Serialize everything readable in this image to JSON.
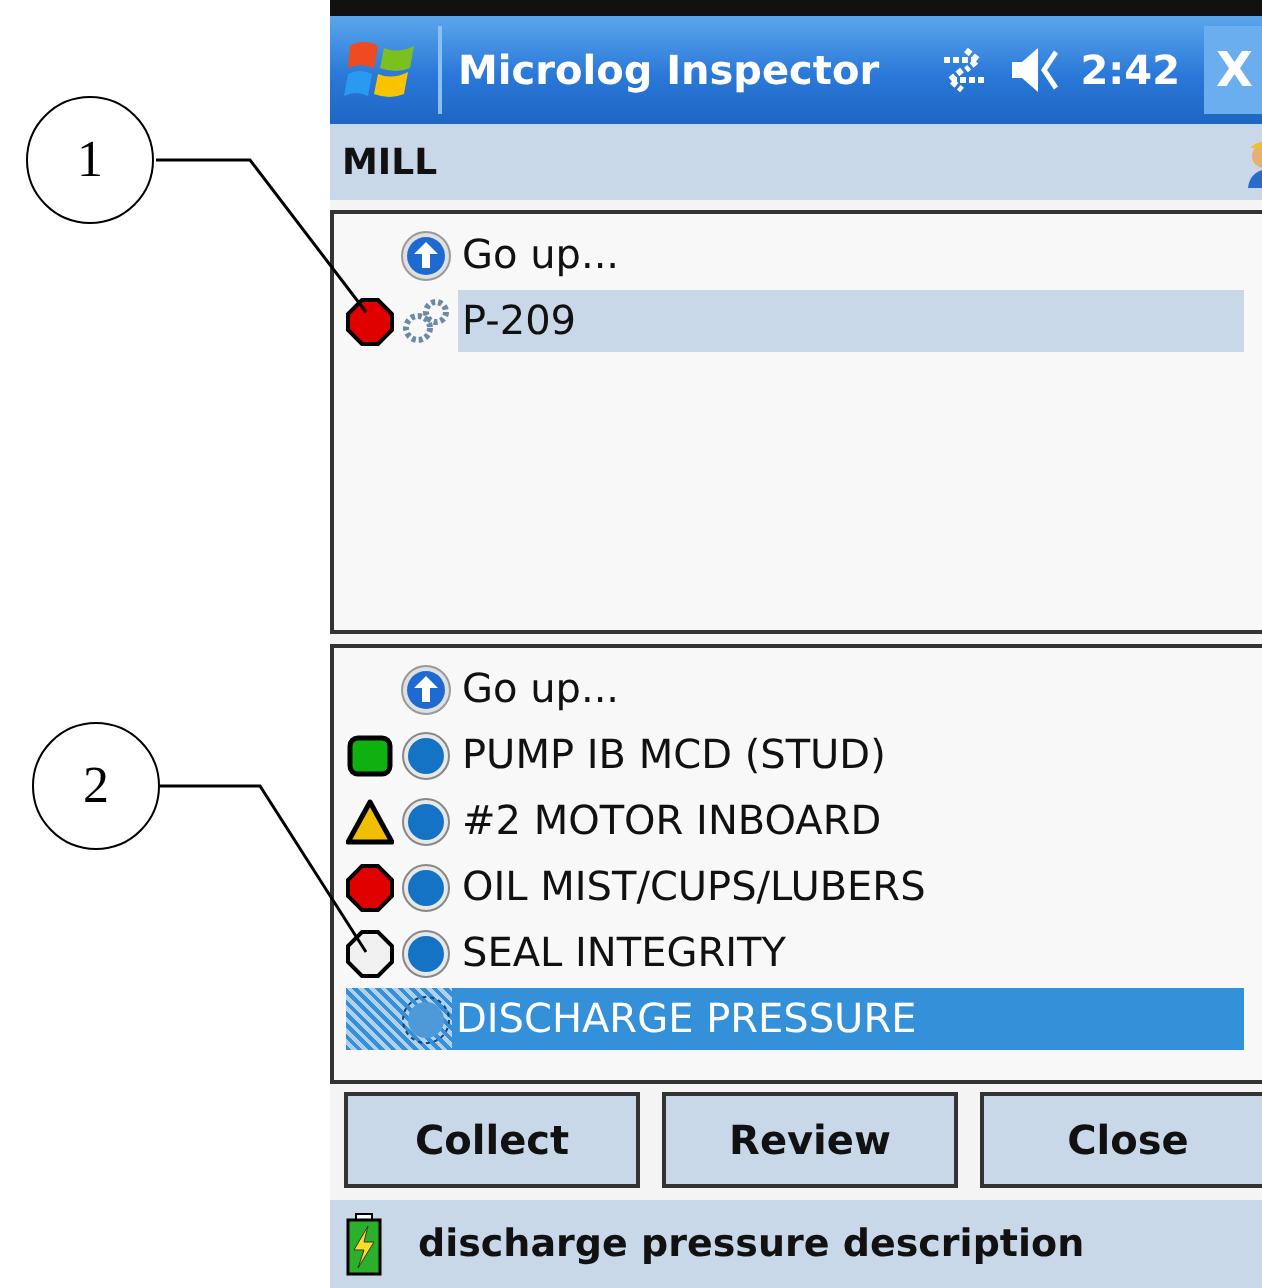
{
  "callouts": [
    {
      "label": "1"
    },
    {
      "label": "2"
    }
  ],
  "title_bar": {
    "title": "Microlog Inspector",
    "time": "2:42",
    "close": "X"
  },
  "header": {
    "title": "MILL"
  },
  "hierarchy_list": {
    "items": [
      {
        "kind": "up",
        "label": "Go up...",
        "selected": false
      },
      {
        "kind": "machine",
        "label": "P-209",
        "status": {
          "kind": "octagon",
          "color": "#e00000"
        },
        "selected": true
      }
    ]
  },
  "point_list": {
    "items": [
      {
        "kind": "up",
        "label": "Go up...",
        "selected": false
      },
      {
        "kind": "point",
        "label": "PUMP IB MCD (STUD)",
        "status": {
          "kind": "square",
          "color": "#10b010"
        },
        "selected": false
      },
      {
        "kind": "point",
        "label": "#2 MOTOR INBOARD",
        "status": {
          "kind": "triangle",
          "color": "#f0c000"
        },
        "selected": false
      },
      {
        "kind": "point",
        "label": "OIL MIST/CUPS/LUBERS",
        "status": {
          "kind": "octagon",
          "color": "#e00000"
        },
        "selected": false
      },
      {
        "kind": "point",
        "label": "SEAL INTEGRITY",
        "status": {
          "kind": "octagon",
          "color": "#f0f0f0"
        },
        "selected": false
      },
      {
        "kind": "point",
        "label": "DISCHARGE PRESSURE",
        "selected": true
      }
    ]
  },
  "buttons": [
    {
      "label": "Collect"
    },
    {
      "label": "Review"
    },
    {
      "label": "Close"
    }
  ],
  "status_bar": {
    "text": "discharge pressure description"
  }
}
